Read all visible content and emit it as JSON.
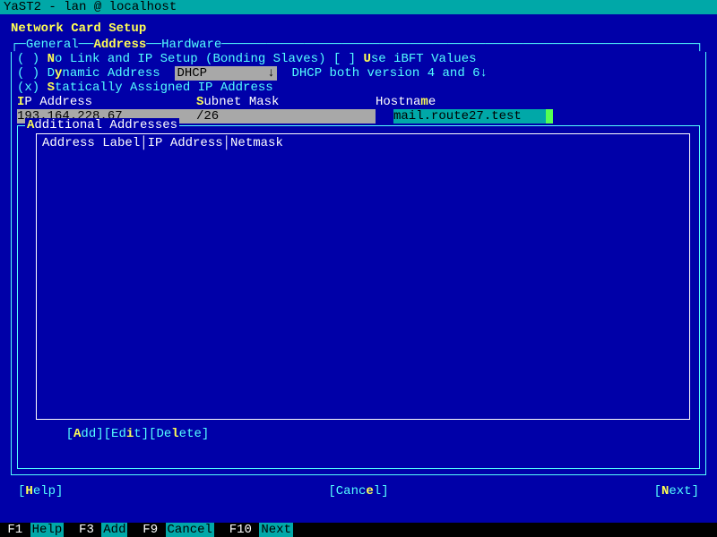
{
  "titlebar": "YaST2 - lan @ localhost",
  "page_title": "Network Card Setup",
  "tabs": {
    "general": "General",
    "address": "Address",
    "hardware": "Hardware"
  },
  "radios": {
    "no_link": "No Link and IP Setup (Bonding Slaves)",
    "use_ibft": "Use iBFT Values",
    "dynamic": "Dynamic Address",
    "static": "Statically Assigned IP Address"
  },
  "dhcp": {
    "mode": "DHCP",
    "version": "DHCP both version 4 and 6"
  },
  "labels": {
    "ip": "IP Address",
    "subnet": "Subnet Mask",
    "hostname": "Hostname"
  },
  "values": {
    "ip": "193.164.228.67",
    "subnet": "/26",
    "hostname": "mail.route27.test"
  },
  "additional": {
    "title": "Additional Addresses",
    "headers": "Address Label│IP Address│Netmask"
  },
  "buttons": {
    "add": "Add",
    "edit": "Edit",
    "delete": "Delete",
    "help": "Help",
    "cancel": "Cancel",
    "next": "Next"
  },
  "fkeys": {
    "f1": "F1",
    "f1l": "Help",
    "f3": "F3",
    "f3l": "Add",
    "f9": "F9",
    "f9l": "Cancel",
    "f10": "F10",
    "f10l": "Next"
  }
}
